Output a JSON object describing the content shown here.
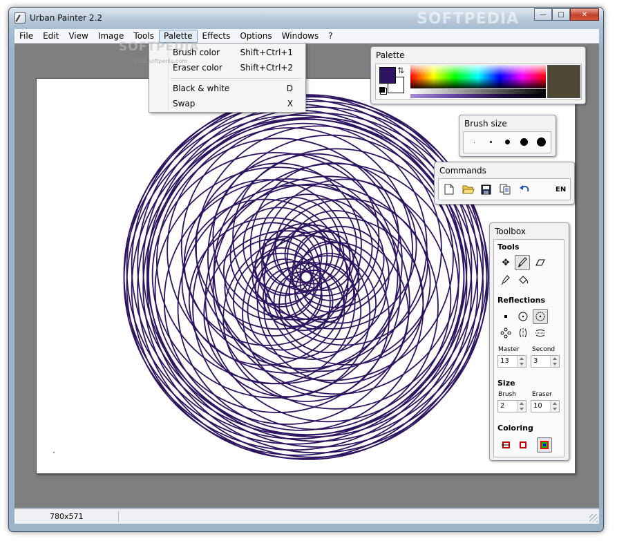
{
  "window": {
    "title": "Urban Painter 2.2",
    "buttons": [
      "minimize",
      "maximize",
      "close"
    ],
    "background_watermark": "SOFTPEDIA"
  },
  "menubar": {
    "items": [
      "File",
      "Edit",
      "View",
      "Image",
      "Tools",
      "Palette",
      "Effects",
      "Options",
      "Windows",
      "?"
    ],
    "active": "Palette"
  },
  "palette_menu": {
    "items": [
      {
        "label": "Brush color",
        "shortcut": "Shift+Ctrl+1"
      },
      {
        "label": "Eraser color",
        "shortcut": "Shift+Ctrl+2"
      },
      {
        "label": "Black & white",
        "shortcut": "D"
      },
      {
        "label": "Swap",
        "shortcut": "X"
      }
    ],
    "watermark": "SOFTPEDIA",
    "watermark_url": "www.softpedia.com"
  },
  "palette_panel": {
    "title": "Palette",
    "brush_color": "#2e1460",
    "eraser_color": "#ffffff",
    "selected_color": "#4d4733"
  },
  "brush_size_panel": {
    "title": "Brush size",
    "sizes": [
      "1",
      "2",
      "3",
      "4",
      "5"
    ]
  },
  "commands_panel": {
    "title": "Commands",
    "icons": [
      "new-file-icon",
      "open-folder-icon",
      "save-icon",
      "copy-icon",
      "undo-icon"
    ],
    "language": "EN"
  },
  "toolbox": {
    "title": "Toolbox",
    "tools_label": "Tools",
    "tools": [
      "move-icon",
      "brush-icon",
      "eraser-icon",
      "eyedropper-icon",
      "fill-bucket-icon"
    ],
    "reflections_label": "Reflections",
    "reflections": [
      "dot-icon",
      "circle-dot-icon",
      "circle-dots-icon",
      "flower-icon",
      "mirror-vertical-icon",
      "mirror-horizontal-icon"
    ],
    "master_label": "Master",
    "master_value": "13",
    "second_label": "Second",
    "second_value": "3",
    "size_label": "Size",
    "brush_label": "Brush",
    "brush_value": "2",
    "eraser_label": "Eraser",
    "eraser_value": "10",
    "coloring_label": "Coloring",
    "coloring": [
      "red-square-icon",
      "square-outline-icon",
      "rainbow-square-icon"
    ]
  },
  "canvas": {
    "stroke_color": "#2e1460"
  },
  "statusbar": {
    "image_size": "780x571"
  }
}
